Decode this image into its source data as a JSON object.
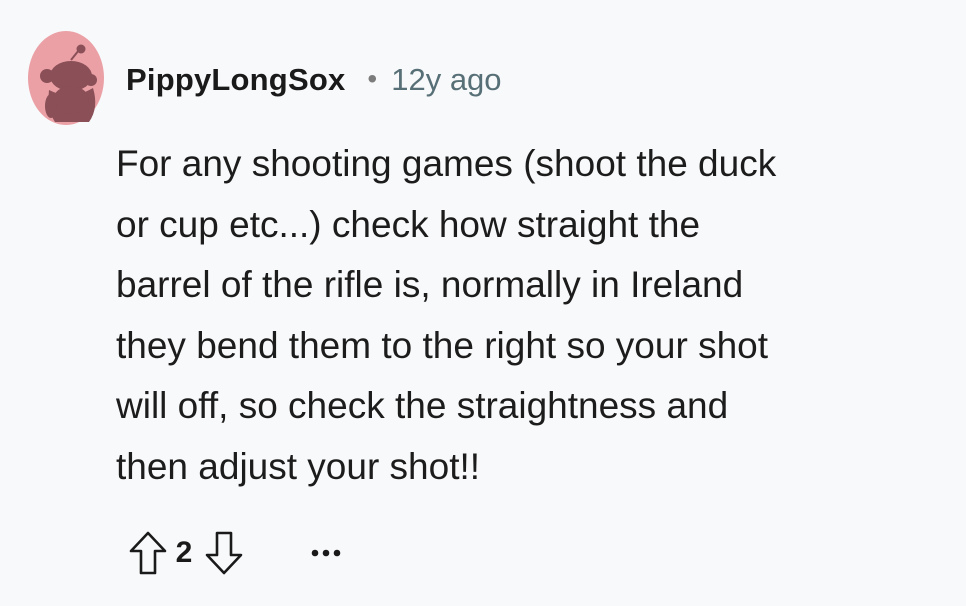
{
  "comment": {
    "author": "PippyLongSox",
    "separator": "•",
    "age": "12y ago",
    "body_lines": [
      "For any shooting games (shoot the duck",
      "or cup etc...) check how straight the",
      "barrel of the rifle is, normally in Ireland",
      "they bend them to the right so your shot",
      "will off, so check the straightness and",
      "then adjust your shot!!"
    ],
    "score": "2"
  },
  "icons": {
    "avatar": "snoo-avatar-icon",
    "upvote": "arrow-up-icon",
    "downvote": "arrow-down-icon",
    "more": "ellipsis-icon"
  },
  "colors": {
    "background": "#f8f9fa",
    "avatar_bg": "#eaa0a5",
    "avatar_figure": "#8a4f57",
    "meta_text": "#576f76"
  }
}
